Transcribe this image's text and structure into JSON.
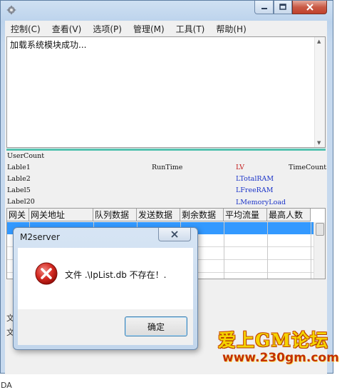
{
  "menu": [
    "控制(C)",
    "查看(V)",
    "选项(P)",
    "管理(M)",
    "工具(T)",
    "帮助(H)"
  ],
  "log": {
    "text": "加载系统模块成功..."
  },
  "status": {
    "user_count": "UserCount",
    "lable1": "Lable1",
    "runtime": "RunTime",
    "lv": "LV",
    "timecount": "TimeCount",
    "lable2": "Lable2",
    "ltotalram": "LTotalRAM",
    "label5": "Label5",
    "lfreeram": "LFreeRAM",
    "label20": "Label20",
    "lmemoryload": "LMemoryLoad"
  },
  "grid": {
    "columns": [
      "网关",
      "网关地址",
      "队列数据",
      "发送数据",
      "剩余数据",
      "平均流量",
      "最高人数"
    ]
  },
  "background": {
    "frag1": "文",
    "frag2": "文",
    "frag3": "DA"
  },
  "dialog": {
    "title": "M2server",
    "message": "文件 .\\IpList.db 不存在！.",
    "ok": "确定"
  },
  "colors": {
    "accent": "#55c2b0",
    "selection": "#3399ff",
    "red_label": "#c21a1a",
    "blue_label": "#1a33c8"
  },
  "watermark": {
    "line1": "爱上GM论坛",
    "line2": "www.230gm.com"
  }
}
